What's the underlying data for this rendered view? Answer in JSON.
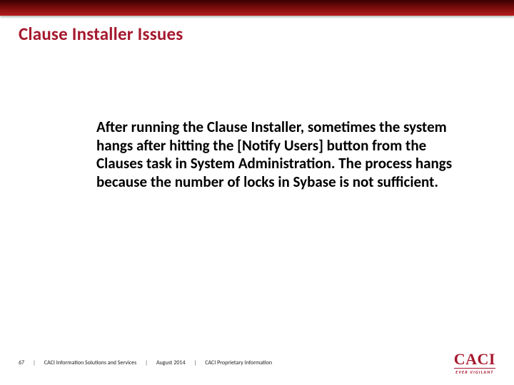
{
  "title": "Clause Installer Issues",
  "body": "After running the Clause Installer, sometimes the system hangs after hitting the [Notify Users] button from the Clauses task in System Administration.  The process hangs because the number of locks in Sybase is not sufficient.",
  "footer": {
    "page": "67",
    "org": "CACI Information Solutions and Services",
    "date": "August 2014",
    "class": "CACI Proprietary Information"
  },
  "logo": {
    "name": "CACI",
    "tagline": "EVER VIGILANT"
  }
}
